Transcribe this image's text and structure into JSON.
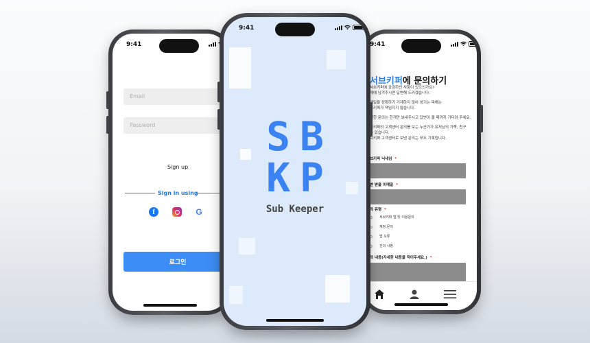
{
  "status_bar": {
    "time": "9:41"
  },
  "login_screen": {
    "email_placeholder": "Email",
    "password_placeholder": "Password",
    "signup_label": "Sign up",
    "sign_in_using_label": "Sign in using",
    "social_icons": [
      "facebook-icon",
      "instagram-icon",
      "google-icon"
    ],
    "login_button_label": "로그인"
  },
  "splash_screen": {
    "logo_line_1": "SB",
    "logo_line_2": "KP",
    "app_name": "Sub Keeper"
  },
  "inquiry_screen": {
    "title_accent": "서브키퍼",
    "title_rest": "에 문의하기",
    "intro_lines": [
      "서브키퍼에 궁금하신 사항이 있으신가요?",
      "래에 남겨주시면 답변해 드리겠습니다."
    ],
    "notice_lines": [
      "메일을 정확하기 기재하지 않아 생기는 피해는",
      "브키퍼가 책임지지 않습니다.",
      "일한 문의는 한개만 보내주시고 답변이 올 때까지 기다려 주세요.",
      "브키퍼의 고객센터 문의를 보는 누군가가 유저님의 가족, 친구",
      "수 있습니다.",
      "브키퍼 고객센터로 보낸 문의는 모두 기록됩니다."
    ],
    "nickname_label": "브키퍼 닉네임",
    "email_label": "변 받을 이메일",
    "type_label": "의 유형",
    "type_options": [
      "서브키퍼 앱 및 이용문의",
      "계정 문의",
      "앱 오류",
      "건의 사항"
    ],
    "content_label": "의 내용(자세한 내용을 적어주세요.)",
    "required_mark": "*",
    "tabbar_icons": [
      "home-icon",
      "profile-icon",
      "menu-icon"
    ]
  },
  "colors": {
    "accent": "#3b82f2",
    "login_button": "#3c8df5",
    "splash_background": "#ddeafb",
    "required": "#e53935"
  }
}
